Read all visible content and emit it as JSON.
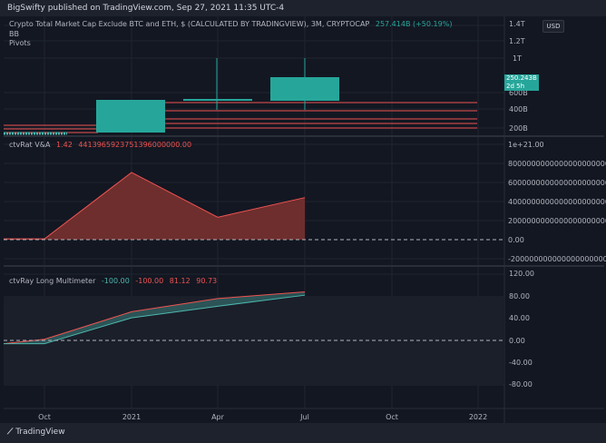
{
  "header": {
    "publisher": "BigSwifty published on TradingView.com, Sep 27, 2021 11:35 UTC-4"
  },
  "main_pane": {
    "title": "Crypto Total Market Cap Exclude BTC and ETH, $ (CALCULATED BY TRADINGVIEW), 3M, CRYPTOCAP",
    "last_value": "257.414B",
    "change": "(+50.19%)",
    "indicators": [
      "BB",
      "Pivots"
    ],
    "currency_button": "USD",
    "price_axis": [
      "1.4T",
      "1.2T",
      "1T",
      "600B",
      "400B",
      "200B"
    ],
    "price_tag_value": "250.243B",
    "price_tag_sub": "2d 5h",
    "colors": {
      "up": "#26a69a",
      "pivot": "#ef5350",
      "bb": "#b0b4bf"
    }
  },
  "rat_pane": {
    "title": "ctvRat V&A",
    "value_a": "1.42",
    "value_b": "4413965923751396000000.00",
    "exponent_label": "1e+21.00",
    "axis": [
      "8000000000000000000000.00",
      "6000000000000000000000.00",
      "4000000000000000000000.00",
      "2000000000000000000000.00",
      "0.00",
      "-2000000000000000000000.00"
    ],
    "series": [
      0.08,
      0.08,
      7.05,
      2.35,
      4.41
    ],
    "colors": {
      "fill": "#6e2e2e",
      "line": "#ef5350"
    }
  },
  "ray_pane": {
    "title": "ctvRay Long Multimeter",
    "value_a": "-100.00",
    "value_b": "-100.00",
    "value_c": "81.12",
    "value_d": "90.73",
    "axis": [
      "120.00",
      "80.00",
      "40.00",
      "0.00",
      "-40.00",
      "-80.00"
    ],
    "upper": [
      -6,
      2,
      52,
      76,
      88
    ],
    "lower": [
      -6,
      -6,
      41,
      62,
      82
    ],
    "colors": {
      "band": "#4db6ac",
      "upper_line": "#ef5350"
    }
  },
  "x_axis": [
    "Oct",
    "2021",
    "Apr",
    "Jul",
    "Oct",
    "2022"
  ],
  "footer": {
    "brand": "TradingView"
  }
}
